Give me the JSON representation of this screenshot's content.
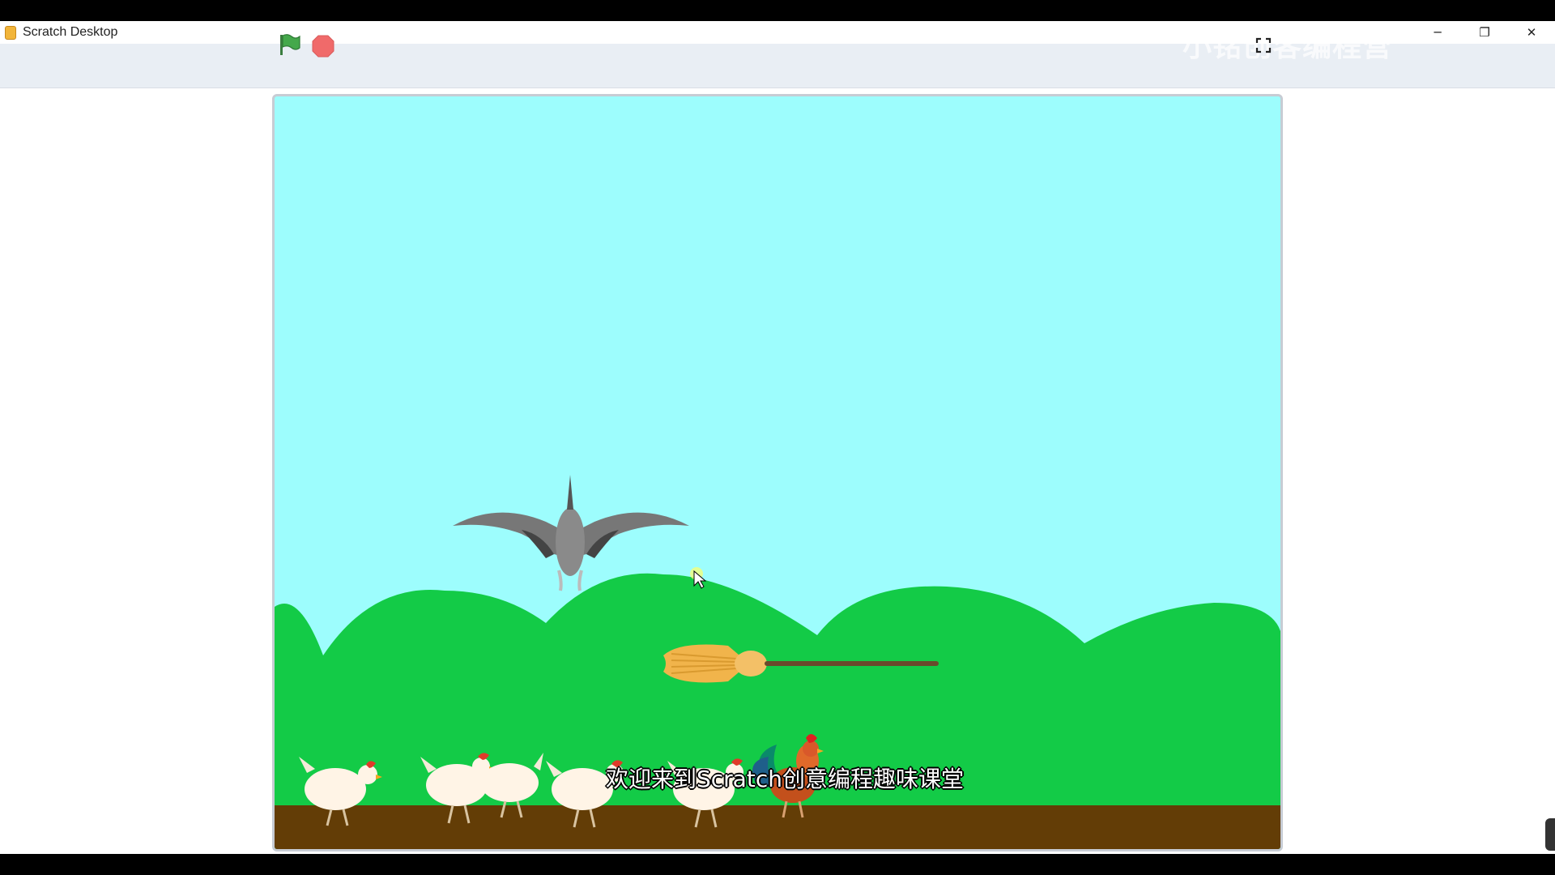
{
  "window": {
    "title": "Scratch Desktop",
    "controls": {
      "minimize": "─",
      "restore": "❐",
      "close": "✕"
    }
  },
  "toolbar": {
    "green_flag_icon": "green-flag-icon",
    "stop_icon": "stop-sign-icon",
    "fullscreen_icon": "fullscreen-icon",
    "watermark": "小铭创客编程营"
  },
  "stage": {
    "sky_color": "#9dfdfd",
    "hill_color": "#13cb47",
    "ground_color": "#633d06"
  },
  "subtitle": "欢迎来到Scratch创意编程趣味课堂",
  "colors": {
    "flag": "#44a84b",
    "stop": "#f06a6a"
  }
}
